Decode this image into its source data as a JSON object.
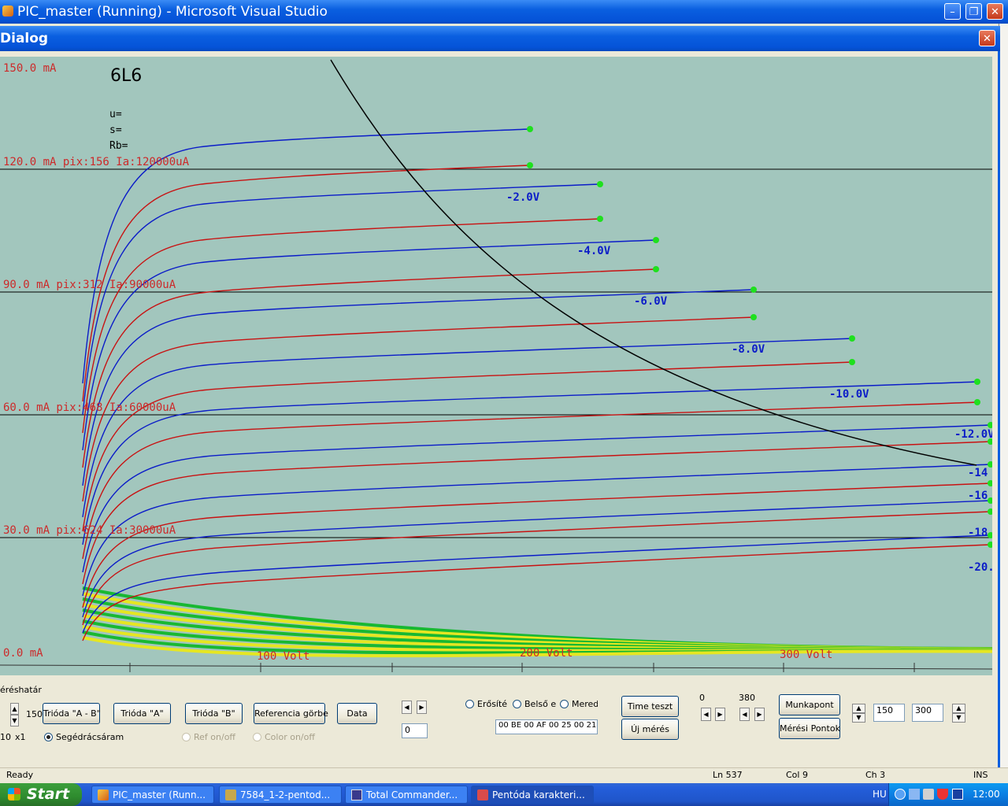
{
  "window_title": "PIC_master (Running) - Microsoft Visual Studio",
  "dialog_title": "Dialog",
  "plot": {
    "tube_name": "6L6",
    "params": [
      "u=",
      "s=",
      "Rb="
    ],
    "y_labels": [
      {
        "text": "150.0 mA",
        "ma": 150
      },
      {
        "text": "120.0 mA pix:156 Ia:120000uA",
        "ma": 120
      },
      {
        "text": "90.0 mA pix:312 Ia:90000uA",
        "ma": 90
      },
      {
        "text": "60.0 mA pix:468 Ia:60000uA",
        "ma": 60
      },
      {
        "text": "30.0 mA pix:624 Ia:30000uA",
        "ma": 30
      },
      {
        "text": "0.0 mA",
        "ma": 0
      }
    ],
    "x_labels": [
      "100 Volt",
      "200 Volt",
      "300 Volt"
    ],
    "grid_labels": [
      "-2.0V",
      "-4.0V",
      "-6.0V",
      "-8.0V",
      "-10.0V",
      "-12.0V",
      "-14",
      "-16",
      "-18",
      "-20."
    ],
    "colors": {
      "background": "#a2c6bd",
      "blue": "#0b1cc8",
      "red": "#c81212",
      "hyperbola": "#000000",
      "marker": "#1ee01e"
    }
  },
  "controls": {
    "mereshatar_label": "éréshatár",
    "spin_value": "150",
    "scale_label_1": "10",
    "scale_label_2": "x1",
    "btn_trioda_ab": "Trióda \"A - B\"",
    "btn_trioda_a": "Trióda \"A\"",
    "btn_trioda_b": "Trióda \"B\"",
    "btn_referencia": "Referencia görbe",
    "btn_data": "Data",
    "radio_segedracs": "Segédrácsáram",
    "check_ref": "Ref on/off",
    "check_color": "Color on/off",
    "center_value": "0",
    "radio_erosite": "Erősíté",
    "radio_belso": "Belső e",
    "radio_mered": "Meredt",
    "hex_value": "00 BE 00 AF 00 25 00 21",
    "btn_time_teszt": "Time teszt",
    "btn_uj_meres": "Új mérés",
    "range_min": "0",
    "range_max": "380",
    "btn_munkapont": "Munkapont",
    "btn_meresi_pontok": "Mérési Pontok",
    "value_a": "150",
    "value_b": "300"
  },
  "status": {
    "ready": "Ready",
    "ln": "Ln 537",
    "col": "Col 9",
    "ch": "Ch 3",
    "ins": "INS"
  },
  "taskbar": {
    "start": "Start",
    "tasks": [
      "PIC_master (Runn...",
      "7584_1-2-pentod...",
      "Total Commander...",
      "Pentóda karakteri..."
    ],
    "lang": "HU",
    "clock": "12:00"
  }
}
